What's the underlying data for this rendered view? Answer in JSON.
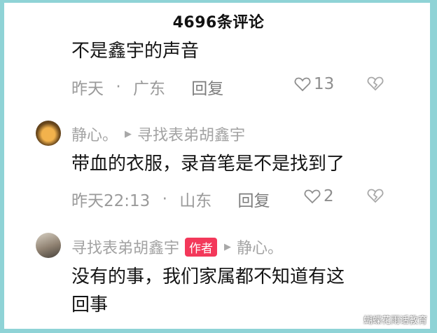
{
  "header": {
    "title": "4696条评论"
  },
  "comments": [
    {
      "text": "不是鑫宇的声音",
      "time": "昨天",
      "region": "广东",
      "reply_label": "回复",
      "likes": "13"
    },
    {
      "user": "静心。",
      "reply_to": "寻找表弟胡鑫宇",
      "text": "带血的衣服，录音笔是不是找到了",
      "time": "昨天22:13",
      "region": "山东",
      "reply_label": "回复",
      "likes": "2"
    },
    {
      "user": "寻找表弟胡鑫宇",
      "badge": "作者",
      "reply_to": "静心。",
      "text_line1": "没有的事，我们家属都不知道有这",
      "text_line2": "回事"
    }
  ],
  "separator": "·",
  "watermark": "蝴蝶花雨话教育",
  "colors": {
    "frame": "#8fd3d6",
    "badge": "#f3385a",
    "meta": "#9a9a9a"
  },
  "icons": [
    "heart-icon",
    "dislike-icon",
    "play-triangle-icon"
  ]
}
